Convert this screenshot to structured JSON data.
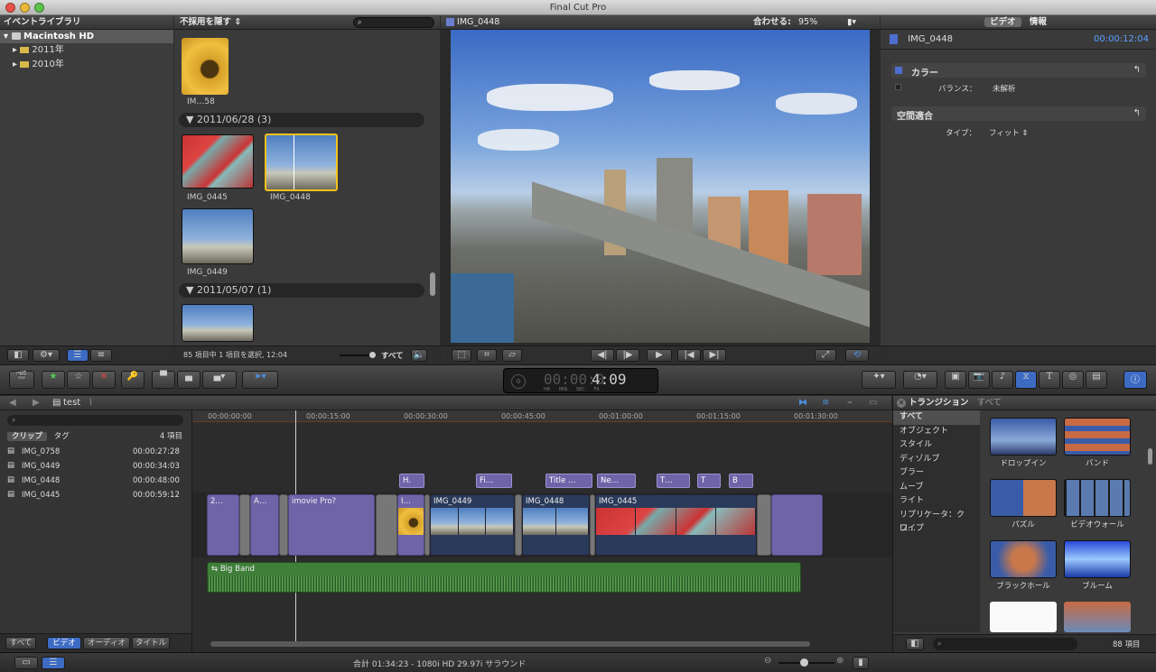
{
  "window": {
    "title": "Final Cut Pro"
  },
  "library": {
    "header": "イベントライブラリ",
    "disk": "Macintosh HD",
    "events": [
      "2011年",
      "2010年"
    ]
  },
  "browser": {
    "filter": "不採用を隠す",
    "top_clip_label": "IM…58",
    "groups": [
      {
        "date": "2011/06/28",
        "count": "(3)"
      },
      {
        "date": "2011/05/07",
        "count": "(1)"
      }
    ],
    "clips": [
      "IMG_0445",
      "IMG_0448",
      "IMG_0449"
    ],
    "status": "85 項目中 1 項目を選択, 12:04",
    "all": "すべて"
  },
  "viewer": {
    "clip": "IMG_0448",
    "fit_label": "合わせる:",
    "zoom": "95%"
  },
  "inspector": {
    "tabs": [
      "ビデオ",
      "情報"
    ],
    "clip": "IMG_0448",
    "timecode": "00:00:12:04",
    "color": {
      "title": "カラー",
      "balance_label": "バランス：",
      "balance_value": "未解析"
    },
    "spatial": {
      "title": "空間適合",
      "type_label": "タイプ：",
      "type_value": "フィット"
    }
  },
  "toolbar": {
    "timecode": "4:09",
    "tc_units": [
      "HR",
      "MIN",
      "SEC",
      "FR"
    ]
  },
  "project": {
    "name": "test",
    "tabs": [
      "クリップ",
      "タグ"
    ],
    "count": "4 項目",
    "clips": [
      {
        "name": "IMG_0758",
        "dur": "00:00:27:28"
      },
      {
        "name": "IMG_0449",
        "dur": "00:00:34:03"
      },
      {
        "name": "IMG_0448",
        "dur": "00:00:48:00"
      },
      {
        "name": "IMG_0445",
        "dur": "00:00:59:12"
      }
    ],
    "filters": [
      "すべて",
      "ビデオ",
      "オーディオ",
      "タイトル"
    ]
  },
  "timeline": {
    "ruler": [
      "00:00:00:00",
      "00:00:15:00",
      "00:00:30:00",
      "00:00:45:00",
      "00:01:00:00",
      "00:01:15:00",
      "00:01:30:00"
    ],
    "titles": [
      "H.",
      "Fi…",
      "Title …",
      "Ne…",
      "T…",
      "T",
      "B"
    ],
    "clips": [
      "2…",
      "A…",
      "imovie Pro?",
      "I…",
      "IMG_0449",
      "IMG_0448",
      "IMG_0445"
    ],
    "audio": "Big Band"
  },
  "transitions": {
    "header": "トランジション",
    "all_label": "すべて",
    "categories": [
      "すべて",
      "オブジェクト",
      "スタイル",
      "ディゾルブ",
      "ブラー",
      "ムーブ",
      "ライト",
      "リプリケータ：クロ…",
      "ワイプ"
    ],
    "items": [
      "ドロップイン",
      "バンド",
      "パズル",
      "ビデオウォール",
      "ブラックホール",
      "ブルーム"
    ],
    "count": "88 項目"
  },
  "statusbar": {
    "text": "合計 01:34:23 - 1080i HD 29.97i サラウンド"
  }
}
